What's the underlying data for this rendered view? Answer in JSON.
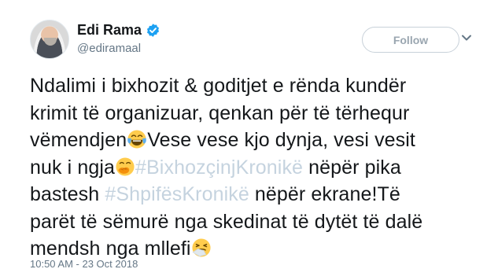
{
  "author": {
    "name": "Edi Rama",
    "handle": "@ediramaal",
    "verified": true
  },
  "actions": {
    "follow_label": "Follow"
  },
  "icons": {
    "verified": "verified-badge-icon",
    "more": "chevron-down-icon",
    "emoji_1": "face-with-tears-of-joy-emoji",
    "emoji_2": "face-with-hand-over-mouth-emoji",
    "emoji_3": "sneezing-face-emoji"
  },
  "tweet": {
    "lines": [
      {
        "text": "Ndalimi i bixhozit & goditjet e rënda kundër"
      },
      {
        "text": "krimit të organizuar, qenkan për të tërhequr"
      },
      {
        "before": "vëmendjen",
        "after": "Vese vese kjo dynja, vesi vesit"
      },
      {
        "before": "nuk i ngja",
        "hashtag": "#BixhozçinjKronikë",
        "after": " nëpër pika"
      },
      {
        "before": "bastesh ",
        "hashtag": "#ShpifësKronikë",
        "after": " nëpër ekrane!Të"
      },
      {
        "text": "parët të sëmurë nga skedinat të dytët të dalë"
      },
      {
        "before": "mendsh nga mllefi"
      }
    ],
    "timestamp": "10:50 AM - 23 Oct 2018"
  },
  "colors": {
    "text": "#14171a",
    "secondary": "#657786",
    "hashtag": "#c5d3df",
    "verified": "#1da1f2",
    "follow_border": "#c8d1d9"
  }
}
